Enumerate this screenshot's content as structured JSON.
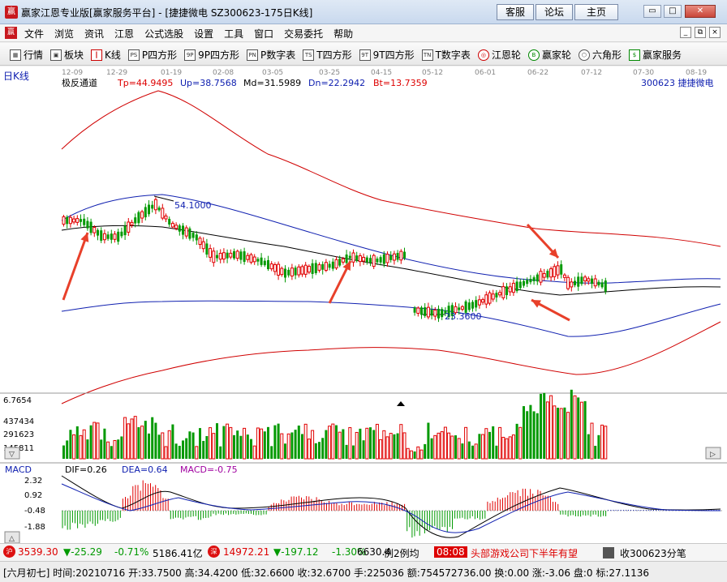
{
  "window": {
    "title": "赢家江恩专业版[赢家服务平台] - [捷捷微电  SZ300623-175日K线]",
    "logo_text": "赢",
    "buttons": [
      "客服",
      "论坛",
      "主页"
    ],
    "controls": [
      "▭",
      "□",
      "✕"
    ]
  },
  "menu": {
    "items": [
      "文件",
      "浏览",
      "资讯",
      "江恩",
      "公式选股",
      "设置",
      "工具",
      "窗口",
      "交易委托",
      "帮助"
    ],
    "mdi_controls": [
      "_",
      "⧉",
      "×"
    ]
  },
  "toolbar": {
    "items": [
      {
        "label": "行情",
        "icon": "grid-icon",
        "glyph": "▦"
      },
      {
        "label": "板块",
        "icon": "block-icon",
        "glyph": "▣"
      },
      {
        "label": "K线",
        "icon": "kline-icon",
        "glyph": "┃"
      },
      {
        "label": "P四方形",
        "icon": "p-square-icon",
        "glyph": "PS"
      },
      {
        "label": "9P四方形",
        "icon": "9p-square-icon",
        "glyph": "9P"
      },
      {
        "label": "P数字表",
        "icon": "p-table-icon",
        "glyph": "PN"
      },
      {
        "label": "T四方形",
        "icon": "t-square-icon",
        "glyph": "TS"
      },
      {
        "label": "9T四方形",
        "icon": "9t-square-icon",
        "glyph": "9T"
      },
      {
        "label": "T数字表",
        "icon": "t-table-icon",
        "glyph": "TN"
      },
      {
        "label": "江恩轮",
        "icon": "gann-wheel-icon",
        "glyph": "◎"
      },
      {
        "label": "赢家轮",
        "icon": "winner-wheel-icon",
        "glyph": "B"
      },
      {
        "label": "六角形",
        "icon": "hexagon-icon",
        "glyph": "⬡"
      },
      {
        "label": "赢家服务",
        "icon": "dollar-icon",
        "glyph": "$"
      }
    ]
  },
  "chart": {
    "period_label": "日K线",
    "stock_label": "300623 捷捷微电",
    "indicator_name": "极反通道",
    "stats": {
      "tp": "Tp=44.9495",
      "up": "Up=38.7568",
      "md": "Md=31.5989",
      "dn": "Dn=22.2942",
      "bt": "Bt=13.7359"
    },
    "date_ticks": [
      "12-09",
      "12-29",
      "01-19",
      "02-08",
      "03-05",
      "03-25",
      "04-15",
      "05-12",
      "06-01",
      "06-22",
      "07-12",
      "07-30",
      "08-19"
    ],
    "high_label": "54.1000",
    "low_label": "23.3600",
    "volume_labels": [
      "6.7654",
      "437434",
      "291623",
      "145811"
    ],
    "macd": {
      "title": "MACD",
      "dif": "DIF=0.26",
      "dea": "DEA=0.64",
      "macd": "MACD=-0.75",
      "ticks": [
        "2.32",
        "0.92",
        "-0.48",
        "-1.88"
      ]
    },
    "colors": {
      "up": "#e00000",
      "down": "#009900",
      "channel_red": "#d00000",
      "channel_blue": "#1020b0",
      "mid": "#000000",
      "arrow": "#e8402a"
    }
  },
  "status": {
    "index1": "3539.30",
    "index1_change": "▼-25.29",
    "index1_pct": "-0.71%",
    "index1_amount": "5186.41亿",
    "index2": "14972.21",
    "index2_change": "▼-197.12",
    "index2_pct": "-1.30%",
    "index2_amount": "6630.4",
    "news_prefix": "例2例均",
    "news_time": "08:08",
    "news_text": "头部游戏公司下半年有望",
    "scroll_label": "收300623分笔",
    "badge1": "沪",
    "badge2": "深",
    "line": "[六月初七] 时间:20210716 开:33.7500 高:34.4200 低:32.6600 收:32.6700 手:225036 额:754572736.00 换:0.00 涨:-3.06 盘:0 标:27.1136"
  }
}
